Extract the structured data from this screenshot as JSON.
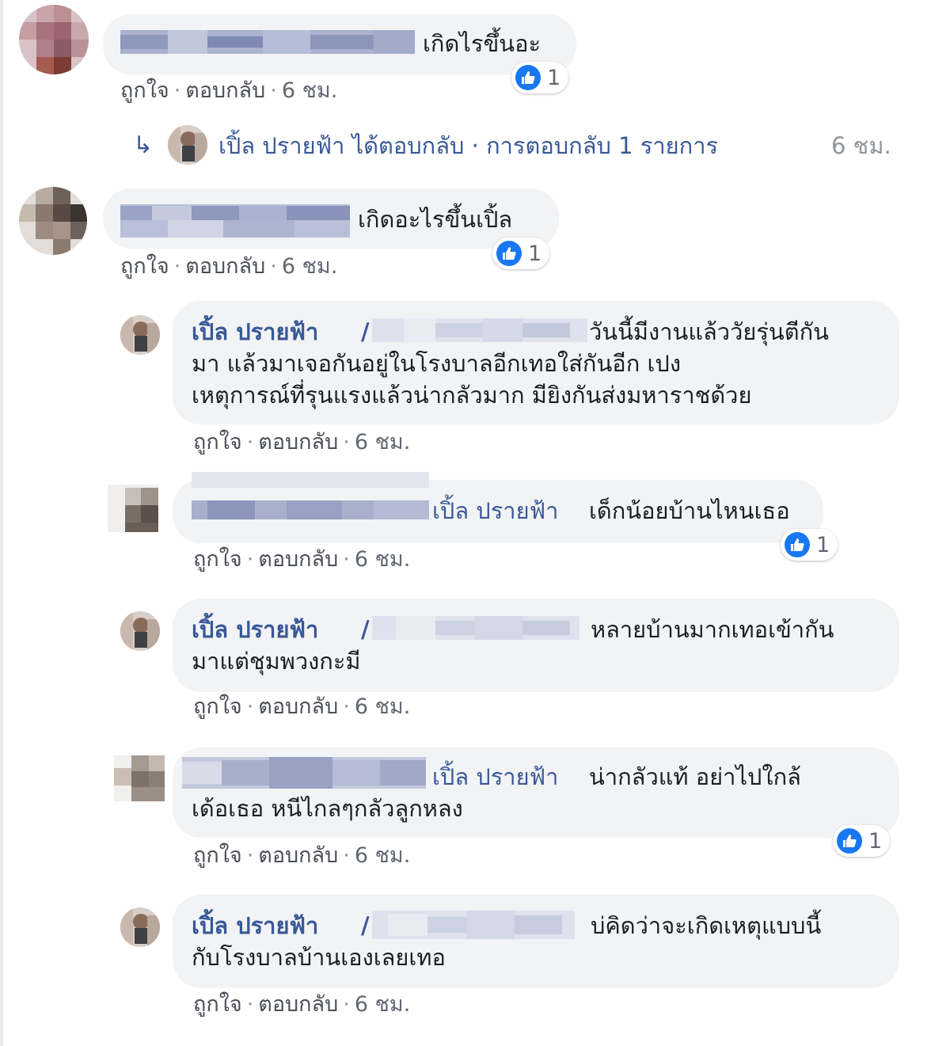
{
  "ui": {
    "like": "ถูกใจ",
    "reply": "ตอบกลับ",
    "time": "6 ชม.",
    "sep": "·"
  },
  "colors": {
    "link": "#385898",
    "bubble": "#f2f3f5",
    "meta": "#606770",
    "like_badge": "#1877f2"
  },
  "comments": [
    {
      "text": "เกิดไรขึ้นอะ",
      "likes": "1"
    },
    {
      "text": "เกิดอะไรขึ้นเปิ้ล",
      "likes": "1"
    }
  ],
  "reply_summary": {
    "author": "เปิ้ล ปรายฟ้า",
    "text": "ได้ตอบกลับ · การตอบกลับ 1 รายการ",
    "time": "6 ชม."
  },
  "replies": [
    {
      "author": "เปิ้ล ปรายฟ้า",
      "lines": [
        "วันนี้มีงานแล้ววัยรุ่นตีกัน",
        "มา แล้วมาเจอกันอยู่ในโรงบาลอีกเทอใส่กันอีก เปง",
        "เหตุการณ์ที่รุนแรงแล้วน่ากลัวมาก มียิงกันส่งมหาราชด้วย"
      ]
    },
    {
      "mention": "เปิ้ล ปรายฟ้า",
      "lines": [
        "เด็กน้อยบ้านไหนเธอ"
      ],
      "likes": "1"
    },
    {
      "author": "เปิ้ล ปรายฟ้า",
      "lines": [
        "หลายบ้านมากเทอเข้ากัน",
        "มาแต่ชุมพวงกะมี"
      ]
    },
    {
      "mention": "เปิ้ล ปรายฟ้า",
      "lines": [
        "น่ากลัวแท้ อย่าไปใกล้",
        "เด้อเธอ หนีไกลๆกลัวลูกหลง"
      ],
      "likes": "1"
    },
    {
      "author": "เปิ้ล ปรายฟ้า",
      "lines": [
        "บ่คิดว่าจะเกิดเหตุแบบนี้",
        "กับโรงบาลบ้านเองเลยเทอ"
      ]
    }
  ]
}
